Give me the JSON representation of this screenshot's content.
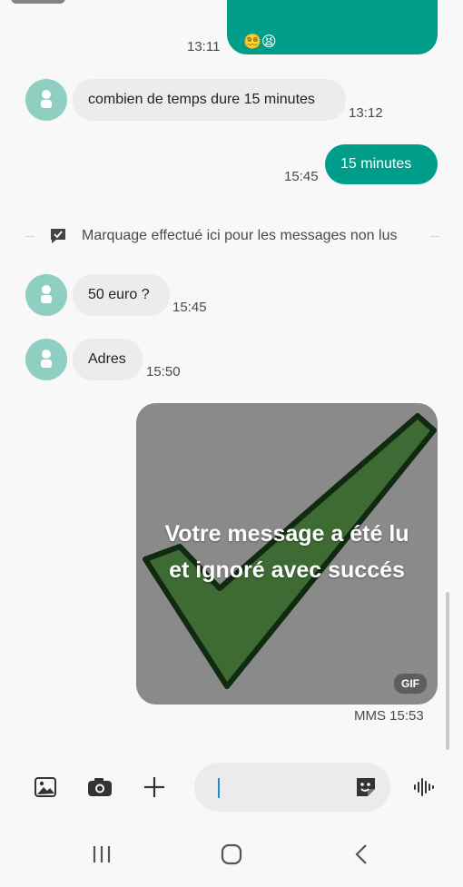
{
  "messages": [
    {
      "id": "m1",
      "direction": "outgoing",
      "partial": true,
      "text": "😵‍💫😫",
      "time": "13:11"
    },
    {
      "id": "m2",
      "direction": "incoming",
      "text": "combien de temps dure 15 minutes",
      "time": "13:12"
    },
    {
      "id": "m3",
      "direction": "outgoing",
      "text": "15 minutes",
      "time": "15:45"
    },
    {
      "id": "m4",
      "direction": "incoming",
      "text": "50 euro ?",
      "time": "15:45"
    },
    {
      "id": "m5",
      "direction": "incoming",
      "text": "Adres",
      "time": "15:50"
    }
  ],
  "unread_marker": {
    "text": "Marquage effectué ici pour les messages non lus",
    "icon": "message-check-icon"
  },
  "mms": {
    "caption_line1": "Votre message a été lu",
    "caption_line2": "et ignoré avec succés",
    "badge": "GIF",
    "meta": "MMS 15:53"
  },
  "composer": {
    "icons": [
      "gallery-icon",
      "camera-icon",
      "plus-icon",
      "sticker-icon",
      "voice-icon"
    ],
    "input_value": ""
  },
  "navbar": {
    "icons": [
      "recents-icon",
      "home-icon",
      "back-icon"
    ]
  },
  "colors": {
    "outgoing": "#009e8a",
    "incoming": "#ececec",
    "avatar": "#8fcfc1",
    "check_fill": "#3e6b33",
    "check_stroke": "#0f2a0e"
  }
}
